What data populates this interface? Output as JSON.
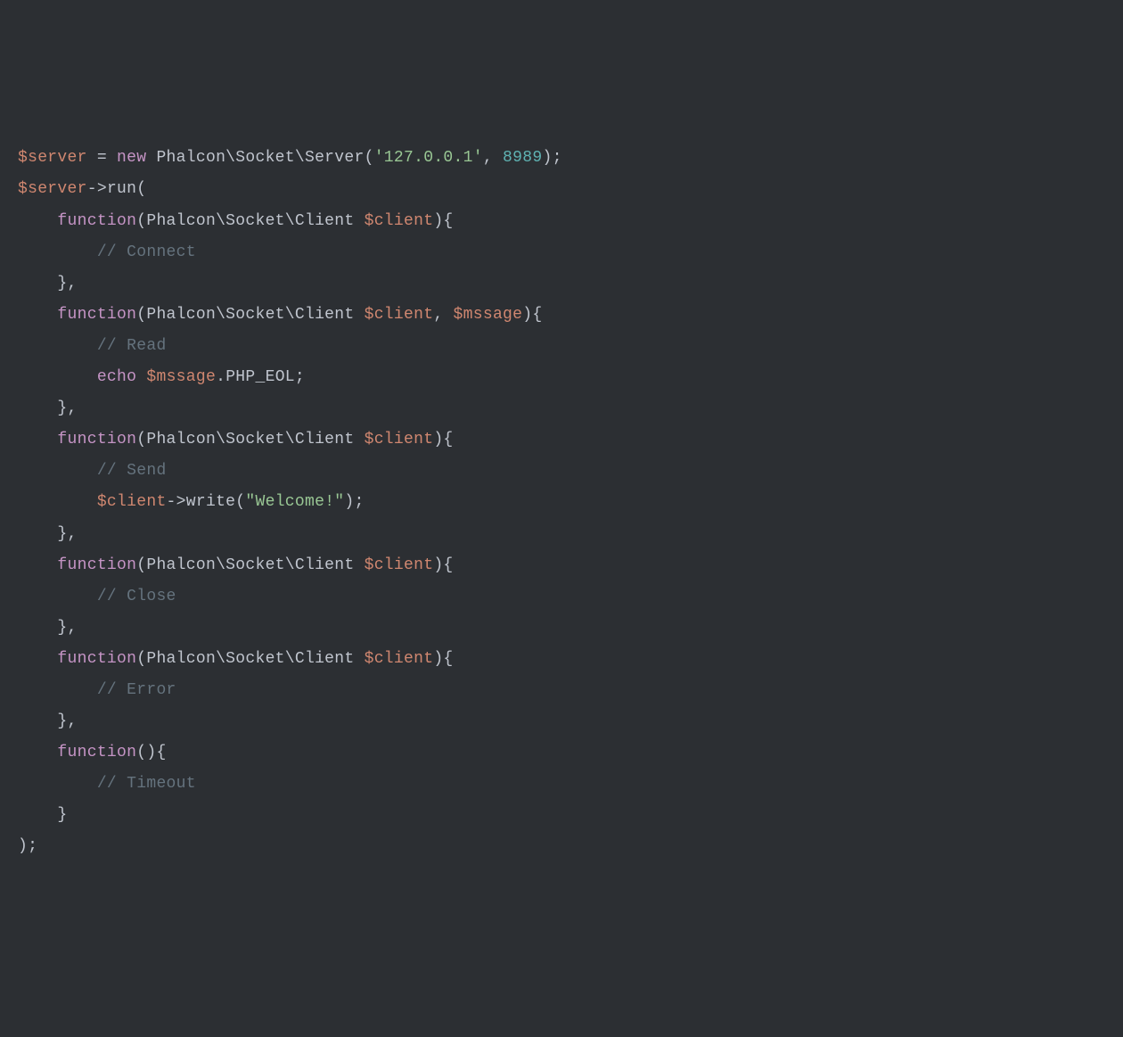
{
  "code": {
    "line1": {
      "var": "$server",
      "eq": " = ",
      "new": "new",
      "space": " ",
      "class": "Phalcon\\Socket\\Server",
      "open": "(",
      "str": "'127.0.0.1'",
      "comma": ", ",
      "num": "8989",
      "close": ");"
    },
    "line2": {
      "var": "$server",
      "arrow": "->",
      "method": "run",
      "open": "("
    },
    "line3": {
      "indent": "    ",
      "kw": "function",
      "args1": "(Phalcon\\Socket\\Client ",
      "var": "$client",
      "args2": "){"
    },
    "line4": {
      "indent": "        ",
      "comment": "// Connect"
    },
    "line5": {
      "indent": "    ",
      "close": "},"
    },
    "line6": {
      "indent": "    ",
      "kw": "function",
      "args1": "(Phalcon\\Socket\\Client ",
      "var1": "$client",
      "comma": ", ",
      "var2": "$mssage",
      "args2": "){"
    },
    "line7": {
      "indent": "        ",
      "comment": "// Read"
    },
    "line8": {
      "indent": "        ",
      "echo": "echo",
      "space": " ",
      "var": "$mssage",
      "dot": ".",
      "const": "PHP_EOL",
      "semi": ";"
    },
    "line9": {
      "indent": "    ",
      "close": "},"
    },
    "line10": {
      "indent": "    ",
      "kw": "function",
      "args1": "(Phalcon\\Socket\\Client ",
      "var": "$client",
      "args2": "){"
    },
    "line11": {
      "indent": "        ",
      "comment": "// Send"
    },
    "line12": {
      "indent": "        ",
      "var": "$client",
      "arrow": "->",
      "method": "write",
      "open": "(",
      "str": "\"Welcome!\"",
      "close": ");"
    },
    "line13": {
      "indent": "    ",
      "close": "},"
    },
    "line14": {
      "indent": "    ",
      "kw": "function",
      "args1": "(Phalcon\\Socket\\Client ",
      "var": "$client",
      "args2": "){"
    },
    "line15": {
      "indent": "        ",
      "comment": "// Close"
    },
    "line16": {
      "indent": "    ",
      "close": "},"
    },
    "line17": {
      "indent": "    ",
      "kw": "function",
      "args1": "(Phalcon\\Socket\\Client ",
      "var": "$client",
      "args2": "){"
    },
    "line18": {
      "indent": "        ",
      "comment": "// Error"
    },
    "line19": {
      "indent": "    ",
      "close": "},"
    },
    "line20": {
      "indent": "    ",
      "kw": "function",
      "args": "(){"
    },
    "line21": {
      "indent": "        ",
      "comment": "// Timeout"
    },
    "line22": {
      "indent": "    ",
      "close": "}"
    },
    "line23": {
      "close": ");"
    }
  }
}
